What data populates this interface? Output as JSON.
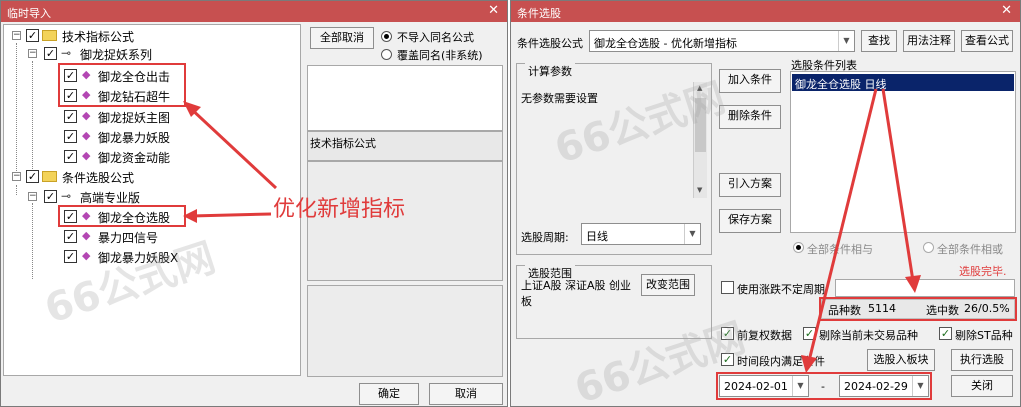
{
  "import_window": {
    "title": "临时导入",
    "close_glyph": "✕",
    "tree": {
      "group1": "技术指标公式",
      "series1": "御龙捉妖系列",
      "items1": [
        "御龙全仓出击",
        "御龙钻石超牛",
        "御龙捉妖主图",
        "御龙暴力妖股",
        "御龙资金动能"
      ],
      "group2": "条件选股公式",
      "series2": "高端专业版",
      "items2": [
        "御龙全仓选股",
        "暴力四信号",
        "御龙暴力妖股X"
      ]
    },
    "deselect_all": "全部取消",
    "radio_no_import": "不导入同名公式",
    "radio_overwrite": "覆盖同名(非系统)",
    "formula_type_label": "技术指标公式",
    "ok": "确定",
    "cancel": "取消",
    "annotation": "优化新增指标"
  },
  "select_window": {
    "title": "条件选股",
    "close_glyph": "✕",
    "formula_label": "条件选股公式",
    "formula_value": "御龙全仓选股 - 优化新增指标",
    "btn_find": "查找",
    "btn_usage": "用法注释",
    "btn_view": "查看公式",
    "calc_params_title": "计算参数",
    "no_params": "无参数需要设置",
    "btn_add": "加入条件",
    "btn_delete": "删除条件",
    "btn_import_plan": "引入方案",
    "btn_save_plan": "保存方案",
    "period_label": "选股周期:",
    "period_value": "日线",
    "cond_list_title": "选股条件列表",
    "cond_list_item": "御龙全仓选股  日线",
    "radio_all_and": "全部条件相与",
    "radio_all_or": "全部条件相或",
    "status": "选股完毕.",
    "range_title": "选股范围",
    "range_value": "上证A股 深证A股 创业板",
    "btn_change_range": "改变范围",
    "use_ups_downs": "使用涨跌不定周期",
    "count_label": "品种数",
    "count_value": "5114",
    "selected_label": "选中数",
    "selected_value": "26/0.5%",
    "chk_adjust": "前复权数据",
    "chk_remove_untraded": "剔除当前未交易品种",
    "chk_remove_st": "剔除ST品种",
    "chk_time_range": "时间段内满足条件",
    "btn_to_block": "选股入板块",
    "btn_run": "执行选股",
    "date_from": "2024-02-01",
    "date_sep": "-",
    "date_to": "2024-02-29",
    "btn_close": "关闭"
  },
  "watermark": "66公式网",
  "colors": {
    "title_bar": "#c75050",
    "annotation_red": "#e03b3b",
    "list_select": "#0a246a"
  }
}
